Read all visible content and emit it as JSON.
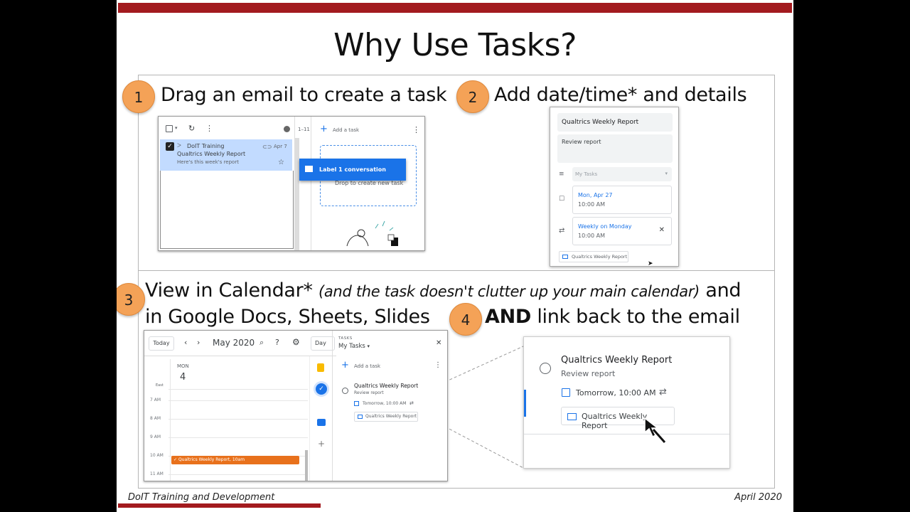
{
  "slide": {
    "title": "Why Use Tasks?",
    "footer_left": "DoIT Training and Development",
    "footer_right": "April 2020"
  },
  "steps": [
    {
      "number": "1",
      "text": "Drag an email to create a task"
    },
    {
      "number": "2",
      "text": "Add date/time* and details"
    },
    {
      "number": "3",
      "text_main": "View in Calendar*",
      "text_note": "(and the task doesn't clutter up your main calendar)",
      "text_end": "and",
      "text_line2": "in Google Docs, Sheets, Slides"
    },
    {
      "number": "4",
      "text_bold": "AND",
      "text_rest": "link back to the email"
    }
  ],
  "shot1": {
    "page_count": "1–11",
    "sender": "DoIT Training",
    "subject": "Qualtrics Weekly Report",
    "snippet": "Here's this week's report",
    "date": "Apr 7",
    "add_task": "Add a task",
    "drag_label": "Label 1 conversation",
    "drop_hint": "Drop to create new task"
  },
  "shot2": {
    "title": "Qualtrics Weekly Report",
    "details": "Review report",
    "list": "My Tasks",
    "date": "Mon, Apr 27",
    "time": "10:00 AM",
    "repeat": "Weekly on Monday",
    "repeat_time": "10:00 AM",
    "email_link": "Qualtrics Weekly Report"
  },
  "shot3": {
    "today": "Today",
    "month": "May 2020",
    "view": "Day",
    "day_name": "MON",
    "day_num": "4",
    "tz": "East",
    "hours": [
      "7 AM",
      "8 AM",
      "9 AM",
      "10 AM",
      "11 AM"
    ],
    "event": "Qualtrics Weekly Report, 10am",
    "tasks_label": "TASKS",
    "tasks_list": "My Tasks",
    "add_task": "Add a task",
    "task_title": "Qualtrics Weekly Report",
    "task_details": "Review report",
    "task_due": "Tomorrow, 10:00 AM",
    "task_email": "Qualtrics Weekly Report"
  },
  "shot4": {
    "task_title": "Qualtrics Weekly Report",
    "task_details": "Review report",
    "task_due": "Tomorrow, 10:00 AM",
    "task_email": "Qualtrics Weekly Report"
  },
  "colors": {
    "accent_red": "#a31b1f",
    "badge": "#f4a257",
    "google_blue": "#1a73e8",
    "event_orange": "#e8711c"
  }
}
